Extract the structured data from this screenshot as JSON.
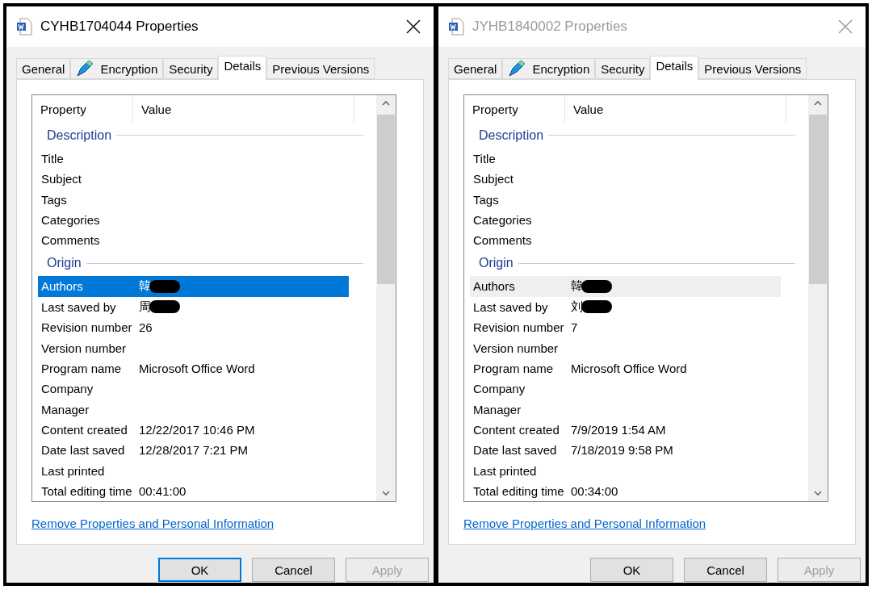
{
  "windows": [
    {
      "title": "CYHB1704044 Properties",
      "active": true,
      "tabs": [
        {
          "label": "General",
          "kind": "text",
          "selected": false
        },
        {
          "label": "Encryption",
          "kind": "icon",
          "selected": false
        },
        {
          "label": "Security",
          "kind": "text",
          "selected": false
        },
        {
          "label": "Details",
          "kind": "text",
          "selected": true
        },
        {
          "label": "Previous Versions",
          "kind": "text",
          "selected": false
        }
      ],
      "columns": [
        "Property",
        "Value"
      ],
      "groups": [
        {
          "title": "Description",
          "rows": [
            {
              "property": "Title",
              "selected": false,
              "redacted": false
            },
            {
              "property": "Subject",
              "selected": false,
              "redacted": false
            },
            {
              "property": "Tags",
              "selected": false,
              "redacted": false
            },
            {
              "property": "Categories",
              "selected": false,
              "redacted": false
            },
            {
              "property": "Comments",
              "selected": false,
              "redacted": false
            }
          ]
        },
        {
          "title": "Origin",
          "rows": [
            {
              "property": "Authors",
              "value": "韓",
              "selected": true,
              "redacted": true
            },
            {
              "property": "Last saved by",
              "value": "周",
              "selected": false,
              "redacted": true
            },
            {
              "property": "Revision number",
              "value": "26",
              "selected": false,
              "redacted": false
            },
            {
              "property": "Version number",
              "selected": false,
              "redacted": false
            },
            {
              "property": "Program name",
              "value": "Microsoft Office Word",
              "selected": false,
              "redacted": false
            },
            {
              "property": "Company",
              "selected": false,
              "redacted": false
            },
            {
              "property": "Manager",
              "selected": false,
              "redacted": false
            },
            {
              "property": "Content created",
              "value": "12/22/2017 10:46 PM",
              "selected": false,
              "redacted": false
            },
            {
              "property": "Date last saved",
              "value": "12/28/2017 7:21 PM",
              "selected": false,
              "redacted": false
            },
            {
              "property": "Last printed",
              "selected": false,
              "redacted": false
            },
            {
              "property": "Total editing time",
              "value": "00:41:00",
              "selected": false,
              "redacted": false
            }
          ]
        }
      ],
      "link": "Remove Properties and Personal Information",
      "buttons": [
        {
          "label": "OK",
          "default": true,
          "disabled": false
        },
        {
          "label": "Cancel",
          "default": false,
          "disabled": false
        },
        {
          "label": "Apply",
          "default": false,
          "disabled": true
        }
      ]
    },
    {
      "title": "JYHB1840002 Properties",
      "active": false,
      "tabs": [
        {
          "label": "General",
          "kind": "text",
          "selected": false
        },
        {
          "label": "Encryption",
          "kind": "icon",
          "selected": false
        },
        {
          "label": "Security",
          "kind": "text",
          "selected": false
        },
        {
          "label": "Details",
          "kind": "text",
          "selected": true
        },
        {
          "label": "Previous Versions",
          "kind": "text",
          "selected": false
        }
      ],
      "columns": [
        "Property",
        "Value"
      ],
      "groups": [
        {
          "title": "Description",
          "rows": [
            {
              "property": "Title",
              "selected": false,
              "redacted": false
            },
            {
              "property": "Subject",
              "selected": false,
              "redacted": false
            },
            {
              "property": "Tags",
              "selected": false,
              "redacted": false
            },
            {
              "property": "Categories",
              "selected": false,
              "redacted": false
            },
            {
              "property": "Comments",
              "selected": false,
              "redacted": false
            }
          ]
        },
        {
          "title": "Origin",
          "rows": [
            {
              "property": "Authors",
              "value": "韓",
              "selected": true,
              "redacted": true
            },
            {
              "property": "Last saved by",
              "value": "刘",
              "selected": false,
              "redacted": true
            },
            {
              "property": "Revision number",
              "value": "7",
              "selected": false,
              "redacted": false
            },
            {
              "property": "Version number",
              "selected": false,
              "redacted": false
            },
            {
              "property": "Program name",
              "value": "Microsoft Office Word",
              "selected": false,
              "redacted": false
            },
            {
              "property": "Company",
              "selected": false,
              "redacted": false
            },
            {
              "property": "Manager",
              "selected": false,
              "redacted": false
            },
            {
              "property": "Content created",
              "value": "7/9/2019 1:54 AM",
              "selected": false,
              "redacted": false
            },
            {
              "property": "Date last saved",
              "value": "7/18/2019 9:58 PM",
              "selected": false,
              "redacted": false
            },
            {
              "property": "Last printed",
              "selected": false,
              "redacted": false
            },
            {
              "property": "Total editing time",
              "value": "00:34:00",
              "selected": false,
              "redacted": false
            }
          ]
        }
      ],
      "link": "Remove Properties and Personal Information",
      "buttons": [
        {
          "label": "OK",
          "default": false,
          "disabled": false
        },
        {
          "label": "Cancel",
          "default": false,
          "disabled": false
        },
        {
          "label": "Apply",
          "default": false,
          "disabled": true
        }
      ]
    }
  ]
}
